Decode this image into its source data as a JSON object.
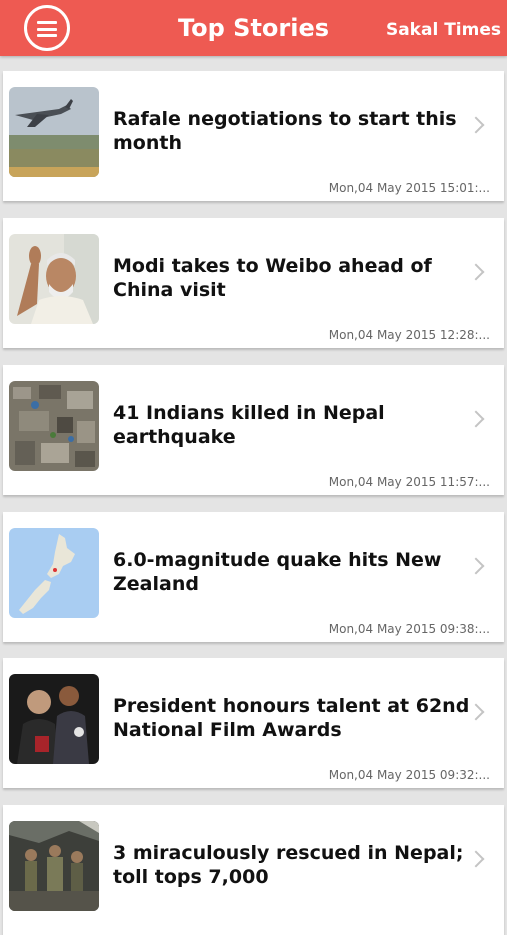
{
  "header": {
    "menu_icon": "hamburger-circle-icon",
    "title": "Top Stories",
    "brand": "Sakal Times",
    "color": "#ee5a52"
  },
  "stories": [
    {
      "headline_1": "Rafale negotiations to start this",
      "headline_2": "month",
      "timestamp": "Mon,04 May 2015 15:01:...",
      "thumb": "fighter-jet-photo"
    },
    {
      "headline_1": "Modi takes to Weibo ahead of",
      "headline_2": "China visit",
      "timestamp": "Mon,04 May 2015 12:28:...",
      "thumb": "modi-waving-photo"
    },
    {
      "headline_1": "41 Indians killed in Nepal",
      "headline_2": "earthquake",
      "timestamp": "Mon,04 May 2015 11:57:...",
      "thumb": "aerial-rubble-photo"
    },
    {
      "headline_1": "6.0-magnitude quake hits New",
      "headline_2": "Zealand",
      "timestamp": "Mon,04 May 2015 09:38:...",
      "thumb": "new-zealand-map"
    },
    {
      "headline_1": "President honours talent at 62nd",
      "headline_2": "National Film Awards",
      "timestamp": "Mon,04 May 2015 09:32:...",
      "thumb": "award-ceremony-photo"
    },
    {
      "headline_1": "3 miraculously rescued in Nepal;",
      "headline_2": "toll tops 7,000",
      "timestamp": "",
      "thumb": "rescue-team-photo"
    }
  ]
}
